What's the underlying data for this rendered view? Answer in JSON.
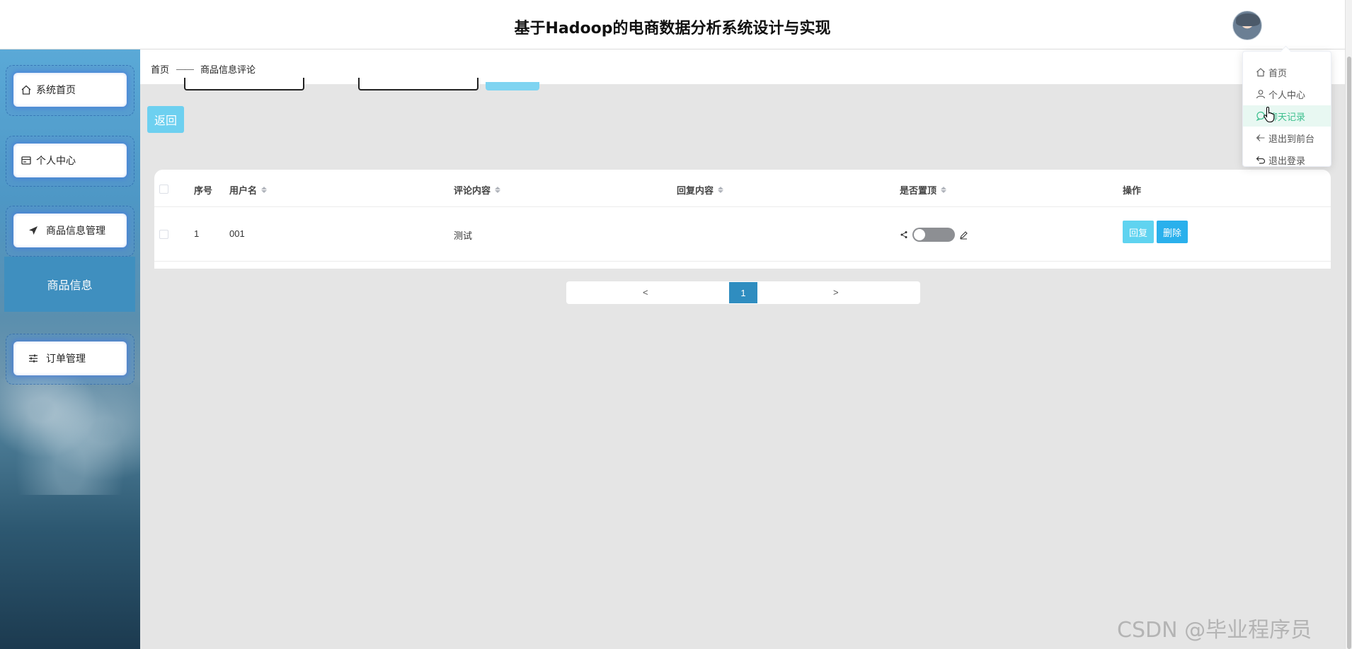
{
  "header": {
    "title": "基于Hadoop的电商数据分析系统设计与实现"
  },
  "sidebar": {
    "items": [
      {
        "label": "系统首页",
        "icon": "home-icon"
      },
      {
        "label": "个人中心",
        "icon": "card-icon"
      },
      {
        "label": "商品信息管理",
        "icon": "send-icon"
      },
      {
        "label": "订单管理",
        "icon": "sliders-icon"
      }
    ],
    "sub_item": "商品信息"
  },
  "breadcrumb": {
    "home": "首页",
    "separator": "——",
    "current": "商品信息评论"
  },
  "toolbar": {
    "back_label": "返回"
  },
  "table": {
    "columns": [
      "序号",
      "用户名",
      "评论内容",
      "回复内容",
      "是否置顶",
      "操作"
    ],
    "rows": [
      {
        "index": "1",
        "username": "001",
        "comment": "测试",
        "reply": "",
        "pinned": false
      }
    ],
    "actions": {
      "reply": "回复",
      "delete": "删除"
    }
  },
  "pagination": {
    "prev": "<",
    "current": "1",
    "next": ">"
  },
  "user_menu": {
    "items": [
      {
        "label": "首页",
        "icon": "home-icon"
      },
      {
        "label": "个人中心",
        "icon": "user-icon"
      },
      {
        "label": "聊天记录",
        "icon": "chat-icon",
        "active": true
      },
      {
        "label": "退出到前台",
        "icon": "back-arrow-icon"
      },
      {
        "label": "退出登录",
        "icon": "logout-icon"
      }
    ]
  },
  "watermark": "CSDN @毕业程序员",
  "colors": {
    "accent": "#2f8dc0",
    "button_light": "#6dd0f0",
    "delete_button": "#2ab0ec",
    "menu_active": "#3cbf8e"
  }
}
